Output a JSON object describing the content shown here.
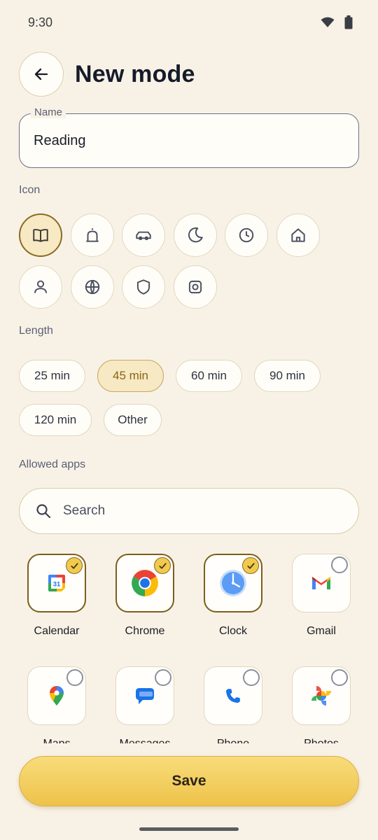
{
  "status_bar": {
    "time": "9:30"
  },
  "header": {
    "title": "New mode"
  },
  "name_field": {
    "label": "Name",
    "value": "Reading"
  },
  "icon_section": {
    "label": "Icon",
    "icons": [
      {
        "name": "book-icon",
        "selected": true
      },
      {
        "name": "bell-icon",
        "selected": false
      },
      {
        "name": "car-icon",
        "selected": false
      },
      {
        "name": "moon-icon",
        "selected": false
      },
      {
        "name": "clock-icon",
        "selected": false
      },
      {
        "name": "home-icon",
        "selected": false
      },
      {
        "name": "person-icon",
        "selected": false
      },
      {
        "name": "globe-icon",
        "selected": false
      },
      {
        "name": "shield-icon",
        "selected": false
      },
      {
        "name": "camera-icon",
        "selected": false
      }
    ]
  },
  "length_section": {
    "label": "Length",
    "options": [
      {
        "label": "25 min",
        "selected": false
      },
      {
        "label": "45 min",
        "selected": true
      },
      {
        "label": "60 min",
        "selected": false
      },
      {
        "label": "90 min",
        "selected": false
      },
      {
        "label": "120 min",
        "selected": false
      },
      {
        "label": "Other",
        "selected": false
      }
    ]
  },
  "apps_section": {
    "label": "Allowed apps",
    "search_placeholder": "Search",
    "apps": [
      {
        "name": "Calendar",
        "checked": true
      },
      {
        "name": "Chrome",
        "checked": true
      },
      {
        "name": "Clock",
        "checked": true
      },
      {
        "name": "Gmail",
        "checked": false
      },
      {
        "name": "Maps",
        "checked": false
      },
      {
        "name": "Messages",
        "checked": false
      },
      {
        "name": "Phone",
        "checked": false
      },
      {
        "name": "Photos",
        "checked": false
      }
    ],
    "calendar_day": "31"
  },
  "footer": {
    "save_label": "Save"
  },
  "colors": {
    "accent": "#f2c94f",
    "selected_border": "#8a6a20",
    "background": "#f8f2e6"
  }
}
